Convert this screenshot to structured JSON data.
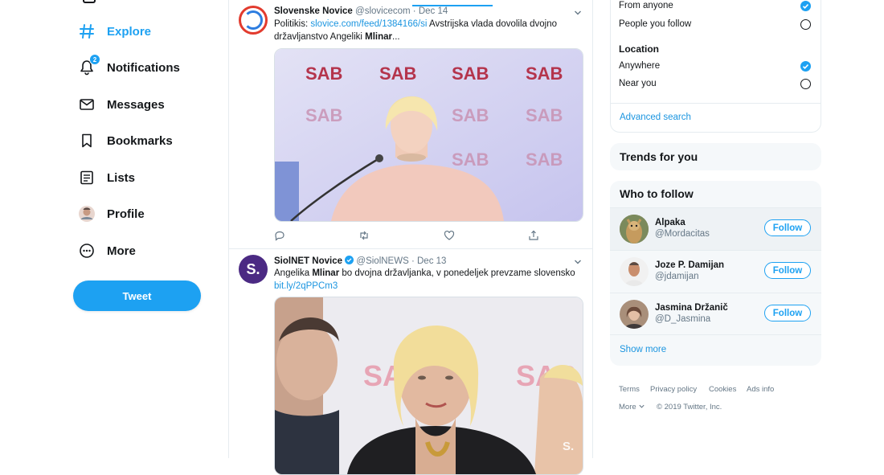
{
  "nav": {
    "explore": "Explore",
    "notifications": "Notifications",
    "notifications_badge": "2",
    "messages": "Messages",
    "bookmarks": "Bookmarks",
    "lists": "Lists",
    "profile": "Profile",
    "more": "More",
    "tweet_button": "Tweet"
  },
  "tweets": [
    {
      "name": "Slovenske Novice",
      "handle": "@slovicecom",
      "date": "Dec 14",
      "text_prefix": "Politikis: ",
      "link": "slovice.com/feed/1384166/si",
      "text_mid": " Avstrijska vlada dovolila dvojno državljanstvo Angeliki ",
      "bold": "Mlinar",
      "text_suffix": "...",
      "media_banner": "SAB"
    },
    {
      "name": "SiolNET Novice",
      "handle": "@SiolNEWS",
      "date": "Dec 13",
      "avatar_letter": "S.",
      "text_prefix": "Angelika ",
      "bold": "Mlinar",
      "text_mid": " bo dvojna državljanka, v ponedeljek prevzame slovensko",
      "link": "bit.ly/2qPPCm3",
      "media_banner": "SAB",
      "media_watermark": "S."
    }
  ],
  "search_filters": {
    "people_options": [
      "From anyone",
      "People you follow"
    ],
    "location_heading": "Location",
    "location_options": [
      "Anywhere",
      "Near you"
    ],
    "advanced_search": "Advanced search"
  },
  "trends": {
    "title": "Trends for you"
  },
  "who_to_follow": {
    "title": "Who to follow",
    "follow_label": "Follow",
    "show_more": "Show more",
    "users": [
      {
        "name": "Alpaka",
        "handle": "@Mordacitas"
      },
      {
        "name": "Joze P. Damijan",
        "handle": "@jdamijan"
      },
      {
        "name": "Jasmina Držanič",
        "handle": "@D_Jasmina"
      }
    ]
  },
  "footer": {
    "terms": "Terms",
    "privacy": "Privacy policy",
    "cookies": "Cookies",
    "ads": "Ads info",
    "more": "More",
    "copyright": "© 2019 Twitter, Inc."
  },
  "colors": {
    "accent": "#1da1f2",
    "link": "#1b95e0",
    "muted": "#657786"
  }
}
